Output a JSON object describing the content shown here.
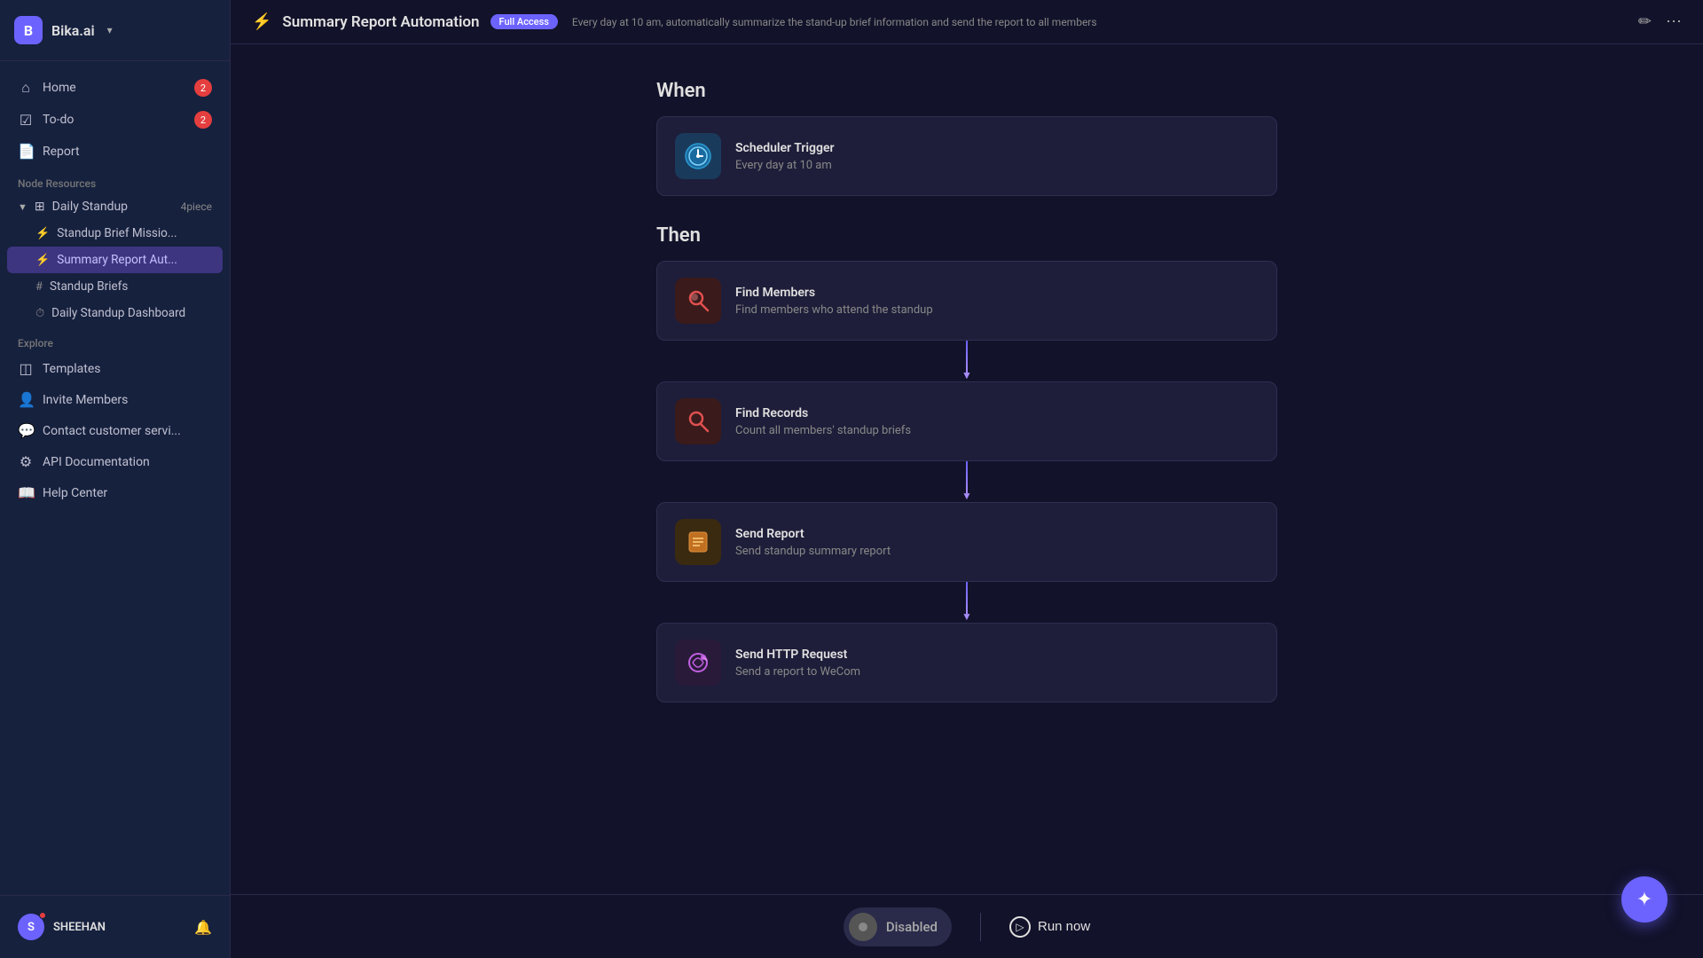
{
  "app": {
    "logo": "B",
    "name": "Bika.ai",
    "chevron": "▾"
  },
  "nav": {
    "items": [
      {
        "id": "home",
        "icon": "⌂",
        "label": "Home",
        "badge": "2"
      },
      {
        "id": "todo",
        "icon": "☑",
        "label": "To-do",
        "badge": "2"
      },
      {
        "id": "report",
        "icon": "📄",
        "label": "Report",
        "badge": ""
      }
    ]
  },
  "sidebar": {
    "node_resources_label": "Node Resources",
    "explore_label": "Explore",
    "daily_standup": {
      "label": "Daily Standup",
      "count": "4piece",
      "children": [
        {
          "id": "standup-brief",
          "icon": "⚡",
          "label": "Standup Brief Missio...",
          "active": false
        },
        {
          "id": "summary-report",
          "icon": "⚡",
          "label": "Summary Report Aut...",
          "active": true
        },
        {
          "id": "standup-briefs",
          "icon": "#",
          "label": "Standup Briefs",
          "active": false
        },
        {
          "id": "daily-standup-dashboard",
          "icon": "⏱",
          "label": "Daily Standup Dashboard",
          "active": false
        }
      ]
    },
    "explore_items": [
      {
        "id": "templates",
        "icon": "◫",
        "label": "Templates"
      },
      {
        "id": "invite-members",
        "icon": "👤",
        "label": "Invite Members"
      },
      {
        "id": "contact-customer",
        "icon": "💬",
        "label": "Contact customer servi..."
      },
      {
        "id": "api-docs",
        "icon": "⚙",
        "label": "API Documentation"
      },
      {
        "id": "help-center",
        "icon": "📖",
        "label": "Help Center"
      }
    ]
  },
  "user": {
    "initial": "S",
    "name": "SHEEHAN"
  },
  "topbar": {
    "icon": "⚡",
    "title": "Summary Report Automation",
    "badge": "Full Access",
    "description": "Every day at 10 am, automatically summarize the stand-up brief information and send the report to all members"
  },
  "workflow": {
    "when_label": "When",
    "then_label": "Then",
    "trigger": {
      "title": "Scheduler Trigger",
      "desc": "Every day at 10 am"
    },
    "steps": [
      {
        "id": "find-members",
        "icon_type": "find-members",
        "icon": "🔍",
        "title": "Find Members",
        "desc": "Find members who attend the standup"
      },
      {
        "id": "find-records",
        "icon_type": "find-records",
        "icon": "🔍",
        "title": "Find Records",
        "desc": "Count all members' standup briefs"
      },
      {
        "id": "send-report",
        "icon_type": "send-report",
        "icon": "📋",
        "title": "Send Report",
        "desc": "Send standup summary report"
      },
      {
        "id": "send-http",
        "icon_type": "http",
        "icon": "🔗",
        "title": "Send HTTP Request",
        "desc": "Send a report to WeCom"
      }
    ]
  },
  "bottom_bar": {
    "toggle_label": "Disabled",
    "run_now_label": "Run now"
  }
}
